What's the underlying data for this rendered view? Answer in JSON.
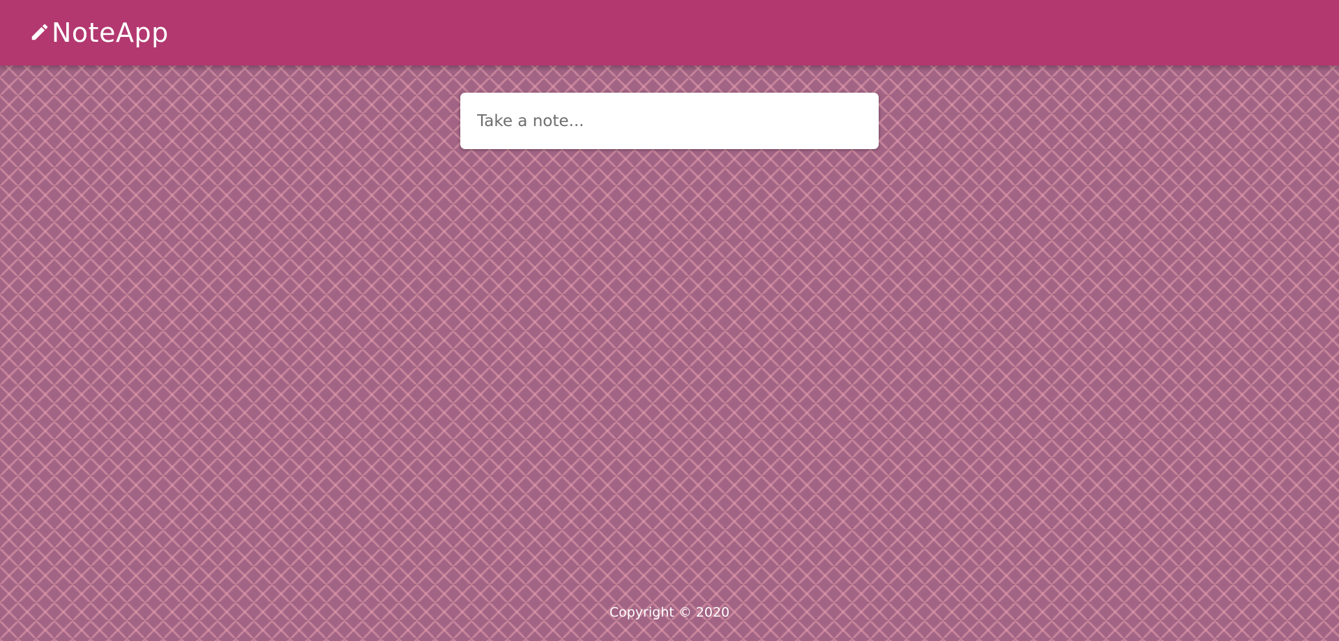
{
  "header": {
    "icon": "pencil-icon",
    "app_name": "NoteApp",
    "background_color": "#b33870"
  },
  "note_input": {
    "value": "",
    "placeholder": "Take a note..."
  },
  "footer": {
    "copyright": "Copyright © 2020"
  },
  "colors": {
    "page_background": "#a26485",
    "header": "#b33870",
    "card": "#ffffff"
  }
}
